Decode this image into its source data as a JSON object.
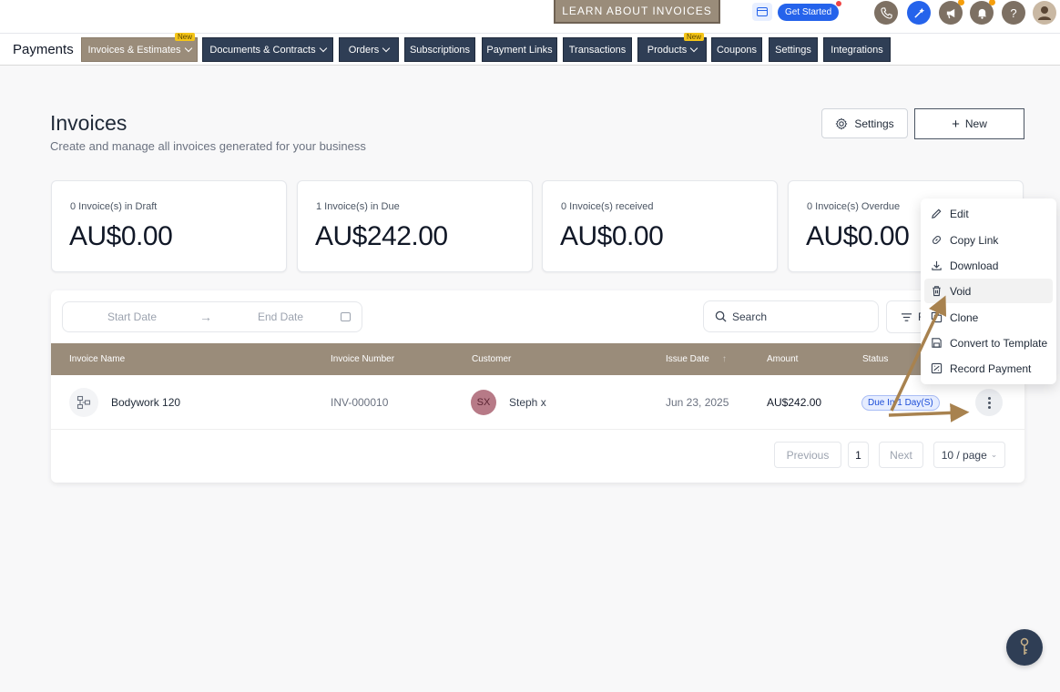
{
  "topbar": {
    "learn_button": "LEARN ABOUT INVOICES",
    "get_started": "Get Started",
    "help_glyph": "?"
  },
  "nav": {
    "title": "Payments",
    "new_badge": "New",
    "tabs": [
      {
        "label": "Invoices & Estimates",
        "dropdown": true,
        "active": true,
        "badge": true
      },
      {
        "label": "Documents & Contracts",
        "dropdown": true
      },
      {
        "label": "Orders",
        "dropdown": true
      },
      {
        "label": "Subscriptions"
      },
      {
        "label": "Payment Links"
      },
      {
        "label": "Transactions"
      },
      {
        "label": "Products",
        "dropdown": true,
        "badge": true
      },
      {
        "label": "Coupons"
      },
      {
        "label": "Settings"
      },
      {
        "label": "Integrations"
      }
    ]
  },
  "page": {
    "title": "Invoices",
    "subtitle": "Create and manage all invoices generated for your business",
    "settings_label": "Settings",
    "new_label": "New"
  },
  "stats": [
    {
      "label": "0 Invoice(s) in Draft",
      "value": "AU$0.00"
    },
    {
      "label": "1 Invoice(s) in Due",
      "value": "AU$242.00"
    },
    {
      "label": "0 Invoice(s) received",
      "value": "AU$0.00"
    },
    {
      "label": "0 Invoice(s) Overdue",
      "value": "AU$0.00"
    }
  ],
  "filters": {
    "start_placeholder": "Start Date",
    "end_placeholder": "End Date",
    "search_placeholder": "Search",
    "filter_label": "F"
  },
  "table": {
    "columns": [
      "Invoice Name",
      "Invoice Number",
      "Customer",
      "Issue Date",
      "Amount",
      "Status"
    ],
    "rows": [
      {
        "name": "Bodywork 120",
        "number": "INV-000010",
        "customer_initials": "SX",
        "customer": "Steph x",
        "issue_date": "Jun 23, 2025",
        "amount": "AU$242.00",
        "status": "Due In 1 Day(S)"
      }
    ]
  },
  "pagination": {
    "previous": "Previous",
    "page": "1",
    "next": "Next",
    "page_size": "10 / page"
  },
  "menu": {
    "items": [
      {
        "label": "Edit",
        "icon": "pencil-icon"
      },
      {
        "label": "Copy Link",
        "icon": "link-icon"
      },
      {
        "label": "Download",
        "icon": "download-icon"
      },
      {
        "label": "Void",
        "icon": "trash-icon"
      },
      {
        "label": "Clone",
        "icon": "clone-icon"
      },
      {
        "label": "Convert to Template",
        "icon": "save-icon"
      },
      {
        "label": "Record Payment",
        "icon": "payment-icon"
      }
    ]
  },
  "colors": {
    "accent": "#9a8c7a",
    "nav_dark": "#2f3e55",
    "annotation_arrow": "#a8824f"
  }
}
